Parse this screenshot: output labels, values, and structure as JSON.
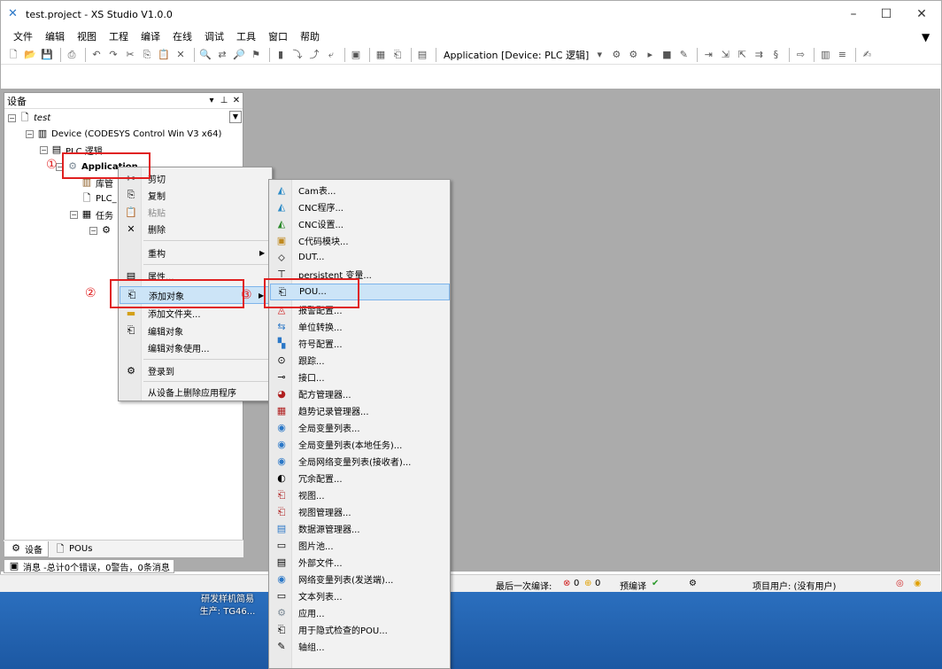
{
  "window": {
    "title": "test.project - XS Studio V1.0.0"
  },
  "menubar": [
    "文件",
    "编辑",
    "视图",
    "工程",
    "编译",
    "在线",
    "调试",
    "工具",
    "窗口",
    "帮助"
  ],
  "toolbar": {
    "app_combo": "Application [Device: PLC 逻辑]"
  },
  "device_panel": {
    "title": "设备",
    "tree": {
      "root": "test",
      "device": "Device (CODESYS Control Win V3 x64)",
      "plc_logic": "PLC 逻辑",
      "application": "Application",
      "library": "库管",
      "plc_prg": "PLC_",
      "task": "任务"
    },
    "tabs": [
      "设备",
      "POUs"
    ]
  },
  "messages": {
    "summary": "消息 -总计0个错误，0警告，0条消息"
  },
  "statusbar": {
    "last_build": "最后一次编译:",
    "errors": "0",
    "warnings": "0",
    "precompile": "预编译",
    "project_user": "项目用户: (没有用户)"
  },
  "desktop": {
    "icon_line1": "研发样机简易",
    "icon_line2": "生产: TG46..."
  },
  "context_menu": {
    "items": [
      {
        "label": "剪切",
        "icon": "cut-icon",
        "enabled": true
      },
      {
        "label": "复制",
        "icon": "copy-icon",
        "enabled": true
      },
      {
        "label": "粘贴",
        "icon": "paste-icon",
        "enabled": false
      },
      {
        "label": "删除",
        "icon": "delete-icon",
        "enabled": true
      },
      {
        "label": "重构",
        "icon": "",
        "enabled": true,
        "submenu": true
      },
      {
        "label": "属性...",
        "icon": "properties-icon",
        "enabled": true
      },
      {
        "label": "添加对象",
        "icon": "add-object-icon",
        "enabled": true,
        "submenu": true,
        "highlighted": true
      },
      {
        "label": "添加文件夹...",
        "icon": "folder-icon",
        "enabled": true
      },
      {
        "label": "编辑对象",
        "icon": "edit-object-icon",
        "enabled": true
      },
      {
        "label": "编辑对象使用...",
        "icon": "",
        "enabled": true
      },
      {
        "label": "登录到",
        "icon": "login-icon",
        "enabled": true
      },
      {
        "label": "从设备上删除应用程序",
        "icon": "",
        "enabled": true
      }
    ]
  },
  "submenu": {
    "items": [
      "Cam表...",
      "CNC程序...",
      "CNC设置...",
      "C代码模块...",
      "DUT...",
      "persistent 变量...",
      "POU...",
      "报警配置...",
      "单位转换...",
      "符号配置...",
      "跟踪...",
      "接口...",
      "配方管理器...",
      "趋势记录管理器...",
      "全局变量列表...",
      "全局变量列表(本地任务)...",
      "全局网络变量列表(接收者)...",
      "冗余配置...",
      "视图...",
      "视图管理器...",
      "数据源管理器...",
      "图片池...",
      "外部文件...",
      "网络变量列表(发送端)...",
      "文本列表...",
      "应用...",
      "用于隐式检查的POU...",
      "轴组..."
    ],
    "highlighted_index": 6
  },
  "annotations": [
    "①",
    "②",
    "③"
  ],
  "colors": {
    "annotation": "#e02020",
    "highlight": "#cce4f7"
  }
}
